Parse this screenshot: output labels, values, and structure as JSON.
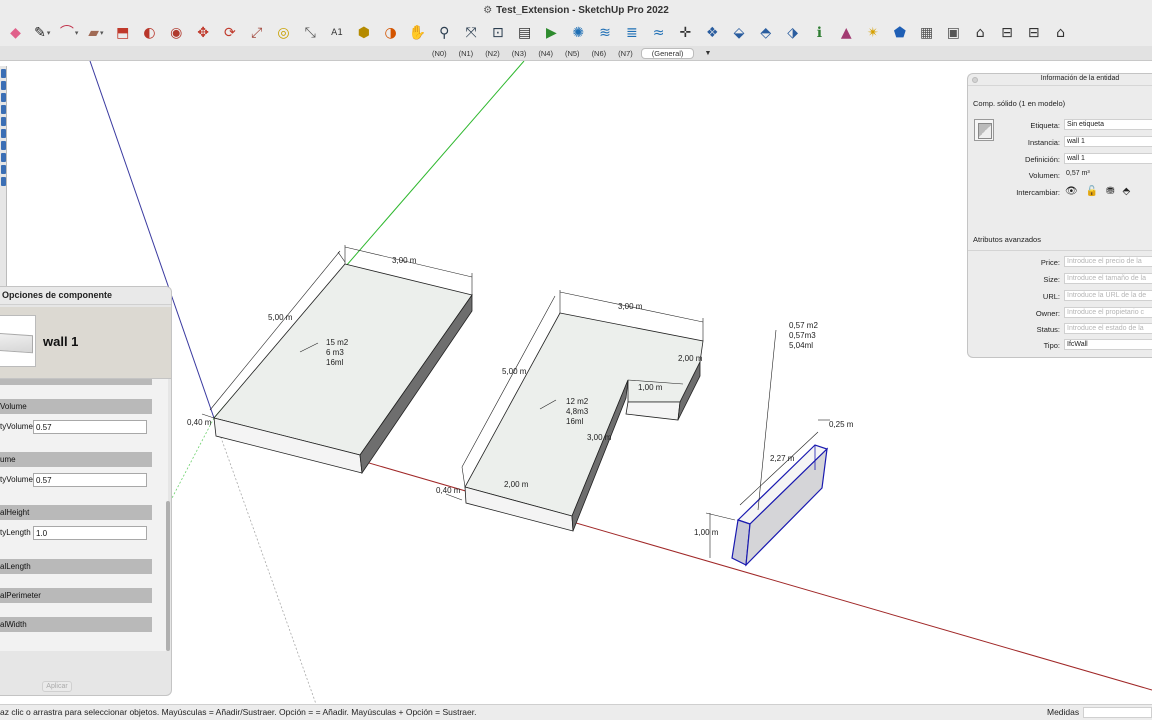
{
  "window": {
    "title": "Test_Extension - SketchUp Pro 2022"
  },
  "toolbar": {
    "tools": [
      {
        "name": "eraser-icon",
        "glyph": "◆",
        "color": "#e0608a",
        "dropdown": false
      },
      {
        "name": "pencil-icon",
        "glyph": "✎",
        "color": "#222222",
        "dropdown": true
      },
      {
        "name": "arc-icon",
        "glyph": "⌒",
        "color": "#c0304a",
        "dropdown": true
      },
      {
        "name": "rectangle-icon",
        "glyph": "▰",
        "color": "#a06a55",
        "dropdown": true
      },
      {
        "name": "push-pull-icon",
        "glyph": "⬒",
        "color": "#c0392b",
        "dropdown": false
      },
      {
        "name": "follow-me-icon",
        "glyph": "◐",
        "color": "#b8362a",
        "dropdown": false
      },
      {
        "name": "offset-icon",
        "glyph": "◉",
        "color": "#b03a2e",
        "dropdown": false
      },
      {
        "name": "move-icon",
        "glyph": "✥",
        "color": "#c0392b",
        "dropdown": false
      },
      {
        "name": "rotate-icon",
        "glyph": "⟳",
        "color": "#c0392b",
        "dropdown": false
      },
      {
        "name": "scale-icon",
        "glyph": "⤢",
        "color": "#a0453a",
        "dropdown": false
      },
      {
        "name": "tape-measure-icon",
        "glyph": "◎",
        "color": "#c8a000",
        "dropdown": false
      },
      {
        "name": "dimension-icon",
        "glyph": "⤡",
        "color": "#555555",
        "dropdown": false
      },
      {
        "name": "text-icon",
        "glyph": "A1",
        "color": "#333333",
        "dropdown": false
      },
      {
        "name": "paint-bucket-icon",
        "glyph": "⬢",
        "color": "#b58b00",
        "dropdown": false
      },
      {
        "name": "section-plane-icon",
        "glyph": "◑",
        "color": "#d35400",
        "dropdown": false
      },
      {
        "name": "walk-icon",
        "glyph": "✋",
        "color": "#d8a84a",
        "dropdown": false
      },
      {
        "name": "zoom-icon",
        "glyph": "⚲",
        "color": "#2c3e50",
        "dropdown": false
      },
      {
        "name": "zoom-extents-icon",
        "glyph": "⤧",
        "color": "#2c3e50",
        "dropdown": false
      },
      {
        "name": "zoom-window-icon",
        "glyph": "⊡",
        "color": "#2c3e50",
        "dropdown": false
      },
      {
        "name": "layout-icon",
        "glyph": "▤",
        "color": "#333333",
        "dropdown": false
      },
      {
        "name": "send-to-layout-icon",
        "glyph": "▶",
        "color": "#2e8b2e",
        "dropdown": false
      },
      {
        "name": "solid-tools-icon",
        "glyph": "✺",
        "color": "#1f6fb5",
        "dropdown": false
      },
      {
        "name": "sandbox-icon",
        "glyph": "≋",
        "color": "#1f6fb5",
        "dropdown": false
      },
      {
        "name": "stamp-icon",
        "glyph": "≣",
        "color": "#1f6fb5",
        "dropdown": false
      },
      {
        "name": "drape-icon",
        "glyph": "≈",
        "color": "#1f6fb5",
        "dropdown": false
      },
      {
        "name": "orbit-icon",
        "glyph": "✛",
        "color": "#333333",
        "dropdown": false
      },
      {
        "name": "warehouse-icon",
        "glyph": "❖",
        "color": "#2a5d9f",
        "dropdown": false
      },
      {
        "name": "extension-warehouse-icon",
        "glyph": "⬙",
        "color": "#2a5d9f",
        "dropdown": false
      },
      {
        "name": "extension-manager-icon",
        "glyph": "⬘",
        "color": "#2a5d9f",
        "dropdown": false
      },
      {
        "name": "3d-warehouse-upload-icon",
        "glyph": "⬗",
        "color": "#2a5d9f",
        "dropdown": false
      },
      {
        "name": "entity-info-icon",
        "glyph": "ℹ",
        "color": "#2e7d32",
        "dropdown": false
      },
      {
        "name": "classifier-icon",
        "glyph": "▲",
        "color": "#a23b72",
        "dropdown": false
      },
      {
        "name": "match-photo-icon",
        "glyph": "✴",
        "color": "#d6a000",
        "dropdown": false
      },
      {
        "name": "sketchy-edges-icon",
        "glyph": "⬟",
        "color": "#1f5fb5",
        "dropdown": false
      },
      {
        "name": "shadows-icon",
        "glyph": "▦",
        "color": "#555555",
        "dropdown": false
      },
      {
        "name": "fog-icon",
        "glyph": "▣",
        "color": "#555555",
        "dropdown": false
      },
      {
        "name": "home-icon",
        "glyph": "⌂",
        "color": "#333333",
        "dropdown": false
      },
      {
        "name": "front-view-icon",
        "glyph": "⊟",
        "color": "#333333",
        "dropdown": false
      },
      {
        "name": "back-view-icon",
        "glyph": "⊟",
        "color": "#333333",
        "dropdown": false
      },
      {
        "name": "house-outline-icon",
        "glyph": "⌂",
        "color": "#333333",
        "dropdown": false
      }
    ]
  },
  "scenes": {
    "tabs": [
      "(N0)",
      "(N1)",
      "(N2)",
      "(N3)",
      "(N4)",
      "(N5)",
      "(N6)",
      "(N7)"
    ],
    "active_tab": "(General)"
  },
  "model": {
    "labels": {
      "slab1_width": "3,00 m",
      "slab1_length": "5,00 m",
      "slab1_height": "0,40 m",
      "slab1_info": [
        "15 m2",
        "6 m3",
        "16ml"
      ],
      "slab2_width": "3,00 m",
      "slab2_length": "5,00 m",
      "slab2_height": "0,40 m",
      "slab2_notch_a": "2,00 m",
      "slab2_notch_b": "1,00 m",
      "slab2_notch_c": "3,00 m",
      "slab2_front": "2,00 m",
      "slab2_info": [
        "12 m2",
        "4,8m3",
        "16ml"
      ],
      "wall_length": "2,27 m",
      "wall_thickness": "0,25 m",
      "wall_height": "1,00 m",
      "wall_info": [
        "0,57 m2",
        "0,57m3",
        "5,04ml"
      ]
    }
  },
  "component_options": {
    "title": "Opciones de componente",
    "component_name": "wall 1",
    "sections": [
      {
        "label": "Volume"
      },
      {
        "label": "ume"
      },
      {
        "label": "alHeight"
      },
      {
        "label": "alLength"
      },
      {
        "label": "alPerimeter"
      },
      {
        "label": "alWidth"
      }
    ],
    "fields": [
      {
        "label": "tyVolume",
        "value": "0.57"
      },
      {
        "label": "tyVolume",
        "value": "0.57"
      },
      {
        "label": "tyLength",
        "value": "1.0"
      }
    ],
    "apply_label": "Aplicar"
  },
  "entity_info": {
    "title": "Información de la entidad",
    "kind": "Comp. sólido (1 en modelo)",
    "rows": [
      {
        "label": "Etiqueta:",
        "value": "Sin etiqueta"
      },
      {
        "label": "Instancia:",
        "value": "wall 1"
      },
      {
        "label": "Definición:",
        "value": "wall 1"
      },
      {
        "label": "Volumen:",
        "value": "0,57 m³"
      }
    ],
    "swap_label": "Intercambiar:",
    "advanced_title": "Atributos avanzados",
    "attributes": [
      {
        "label": "Price:",
        "placeholder": "Introduce el precio de la"
      },
      {
        "label": "Size:",
        "placeholder": "Introduce el tamaño de la"
      },
      {
        "label": "URL:",
        "placeholder": "Introduce la URL de la de"
      },
      {
        "label": "Owner:",
        "placeholder": "Introduce el propietario c"
      },
      {
        "label": "Status:",
        "placeholder": "Introduce el estado de la"
      }
    ],
    "type_label": "Tipo:",
    "type_value": "IfcWall"
  },
  "status": {
    "message": "az clic o arrastra para seleccionar objetos. Mayúsculas = Añadir/Sustraer. Opción = = Añadir. Mayúsculas + Opción = Sustraer.",
    "measures_label": "Medidas"
  }
}
